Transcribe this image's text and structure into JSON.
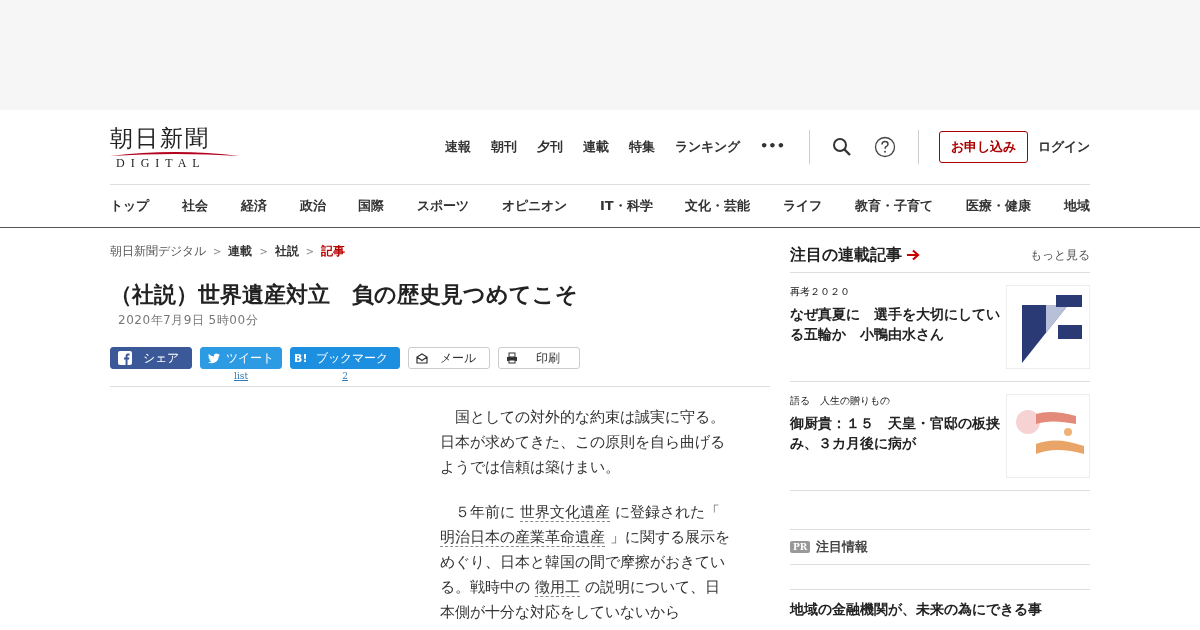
{
  "logo": {
    "title": "朝日新聞",
    "subtitle": "DIGITAL"
  },
  "top_nav": [
    "速報",
    "朝刊",
    "夕刊",
    "連載",
    "特集",
    "ランキング",
    "•••"
  ],
  "apply_button": "お申し込み",
  "login": "ログイン",
  "category_nav": [
    "トップ",
    "社会",
    "経済",
    "政治",
    "国際",
    "スポーツ",
    "オピニオン",
    "IT・科学",
    "文化・芸能",
    "ライフ",
    "教育・子育て",
    "医療・健康",
    "地域"
  ],
  "breadcrumb": [
    {
      "label": "朝日新聞デジタル",
      "selected": false
    },
    {
      "label": "連載",
      "selected": false
    },
    {
      "label": "社説",
      "selected": false
    },
    {
      "label": "記事",
      "selected": true
    }
  ],
  "breadcrumb_separator": ">",
  "article": {
    "title": "（社説）世界遺産対立　負の歴史見つめてこそ",
    "date": "2020年7月9日 5時00分",
    "share_buttons": [
      {
        "kind": "facebook",
        "label": "シェア"
      },
      {
        "kind": "twitter",
        "label": "ツイート",
        "count": "list"
      },
      {
        "kind": "hatena",
        "icon_text": "B!",
        "label": "ブックマーク",
        "count": "2"
      },
      {
        "kind": "mail",
        "label": "メール"
      },
      {
        "kind": "print",
        "label": "印刷"
      }
    ],
    "paragraphs": [
      {
        "segments": [
          {
            "text": "　国としての対外的な約束は誠実に守る。日本が求めてきた、この原則を自ら曲げるようでは信頼は築けまい。",
            "link": false
          }
        ]
      },
      {
        "segments": [
          {
            "text": "　５年前に ",
            "link": false
          },
          {
            "text": "世界文化遺産",
            "link": true
          },
          {
            "text": " に登録された「 ",
            "link": false
          },
          {
            "text": "明治日本の産業革命遺産",
            "link": true
          },
          {
            "text": " 」に関する展示をめぐり、日本と韓国の間で摩擦がおきている。戦時中の ",
            "link": false
          },
          {
            "text": "徴用工",
            "link": true
          },
          {
            "text": " の説明について、日本側が十分な対応をしていないから",
            "link": false
          }
        ]
      }
    ]
  },
  "sidebar": {
    "heading": "注目の連載記事",
    "more": "もっと見る",
    "items": [
      {
        "series": "再考２０２０",
        "title": "なぜ真夏に　選手を大切にしている五輪か　小鴨由水さん",
        "kind": "picture"
      },
      {
        "series": "語る　人生の贈りもの",
        "title": "御厨貴：１５　天皇・官邸の板挟み、３カ月後に病が",
        "kind": "picture"
      }
    ]
  },
  "pr": {
    "badge": "PR",
    "heading": "注目情報",
    "title": "地域の金融機関が、未来の為にできる事"
  }
}
